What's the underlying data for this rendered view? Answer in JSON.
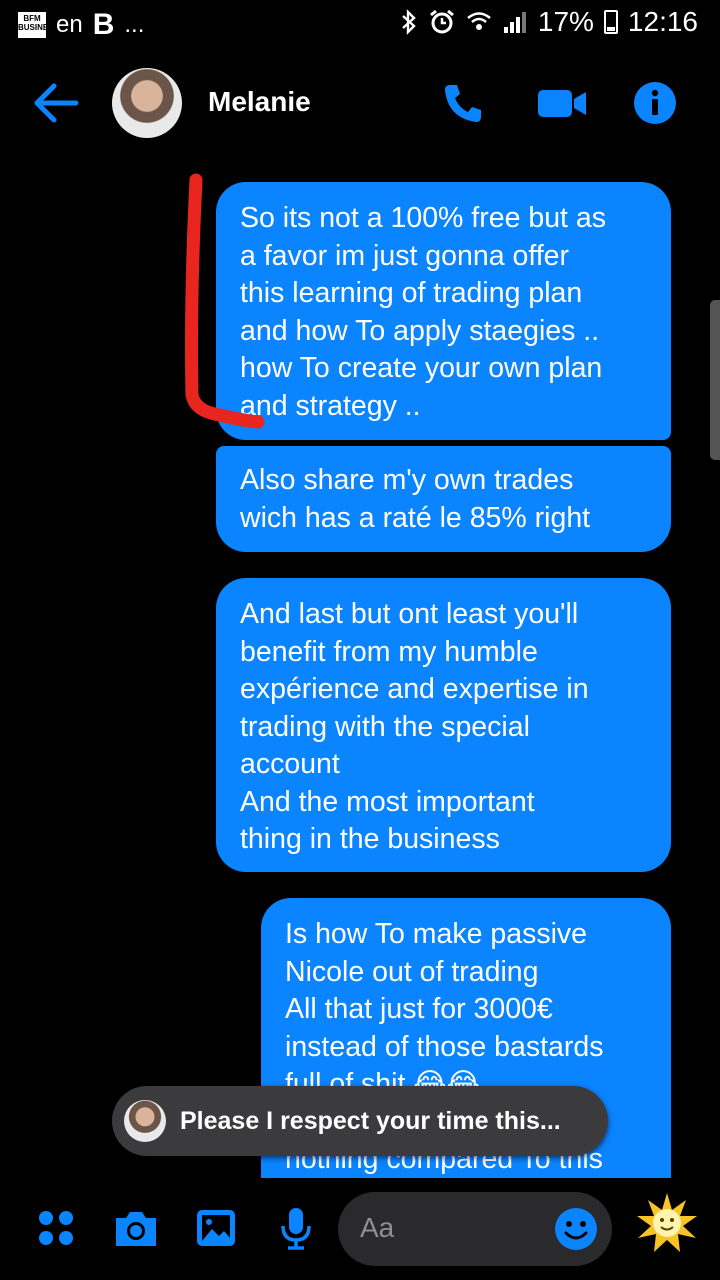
{
  "status_bar": {
    "app_badge": "BFM BUSINESS",
    "lang": "en",
    "app_letter": "B",
    "ellipsis": "...",
    "battery": "17%",
    "time": "12:16"
  },
  "header": {
    "contact_name": "Melanie",
    "icons": [
      "back-arrow-icon",
      "phone-icon",
      "video-camera-icon",
      "info-icon"
    ],
    "accent": "#0b84ff"
  },
  "messages": [
    {
      "text": "So its not a 100% free but as\na favor im just gonna offer\nthis learning of trading plan\nand how To apply staegies ..\nhow To create your own plan\nand strategy .."
    },
    {
      "text": "Also share m'y own trades\nwich has a raté le 85% right"
    },
    {
      "text": "And last but ont least you'll\nbenefit from my humble\nexpérience and expertise in\ntrading with the special\naccount\nAnd the most important\nthing in the business"
    },
    {
      "text": "Is how To make passive\nNicole out of trading\nAll that just for 3000€\ninstead of those bastards\nfull of shit 😂😂\n\nnothing compared To this"
    }
  ],
  "toast": {
    "text": "Please I respect your time this..."
  },
  "composer": {
    "placeholder": "Aa",
    "icons": [
      "apps-icon",
      "camera-icon",
      "image-icon",
      "microphone-icon",
      "emoji-icon",
      "sun-sticker-icon"
    ]
  },
  "colors": {
    "bubble": "#0b84ff",
    "background": "#000000",
    "annotation": "#e8251f"
  }
}
